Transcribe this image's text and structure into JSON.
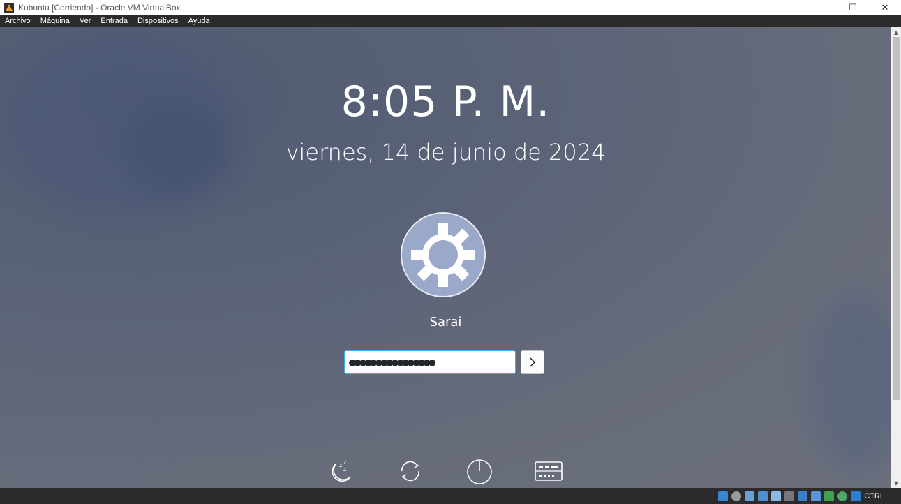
{
  "window": {
    "title": "Kubuntu [Corriendo] - Oracle VM VirtualBox",
    "controls": {
      "minimize": "—",
      "maximize": "☐",
      "close": "✕"
    }
  },
  "menubar": {
    "items": [
      "Archivo",
      "Máquina",
      "Ver",
      "Entrada",
      "Dispositivos",
      "Ayuda"
    ]
  },
  "lockscreen": {
    "time": "8:05 P. M.",
    "date": "viernes, 14 de junio de 2024",
    "username": "Sarai",
    "password_mask": "●●●●●●●●●●●●●●●●",
    "actions": [
      "sleep-icon",
      "switch-user-icon",
      "shutdown-icon",
      "virtual-keyboard-icon"
    ],
    "accent_color": "#3daee9"
  },
  "statusbar": {
    "host_key": "CTRL",
    "icons": [
      "hard-disk-icon",
      "optical-drive-icon",
      "audio-icon",
      "network-icon",
      "usb-icon",
      "shared-folder-icon",
      "display-icon",
      "recording-icon",
      "cpu-icon",
      "mouse-integration-icon",
      "keyboard-icon"
    ]
  }
}
